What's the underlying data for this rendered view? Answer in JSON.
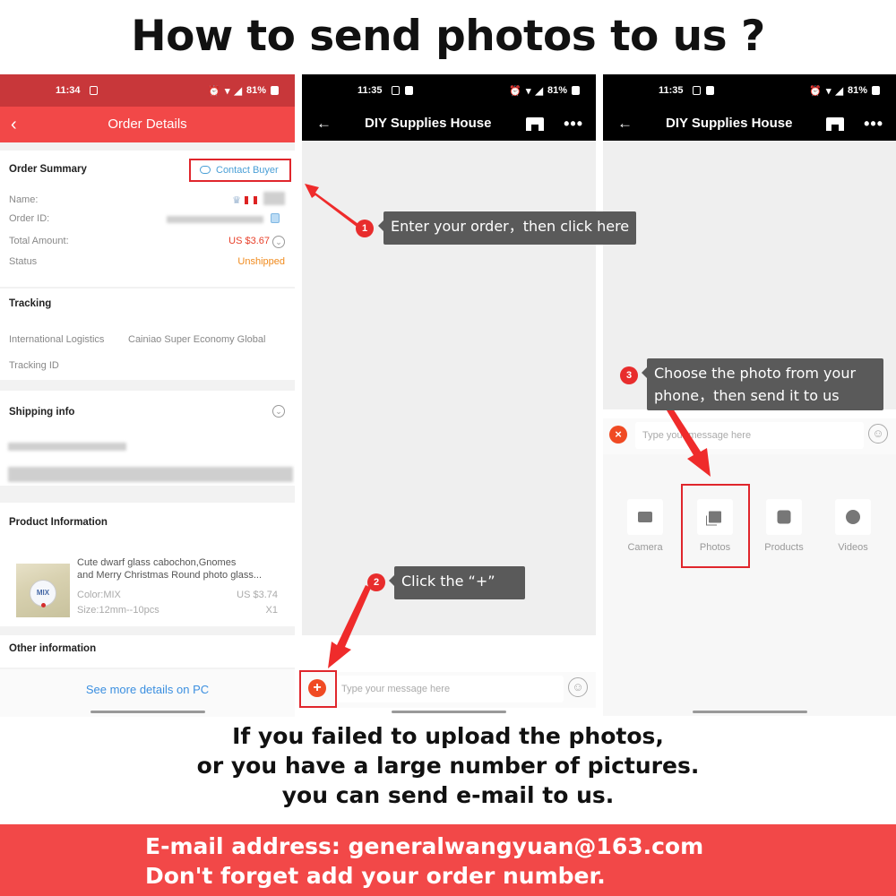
{
  "headline": "How to send photos to us ?",
  "colors": {
    "accent_red": "#f24848",
    "highlight_red": "#e0262c",
    "link_blue": "#4a9fd6",
    "price_red": "#e8402a",
    "status_orange": "#f08a1c",
    "tooltip_gray": "#5a5a5a"
  },
  "screen1": {
    "status": {
      "time": "11:34",
      "battery": "81%"
    },
    "appbar": {
      "back_icon": "chevron-left-icon",
      "title": "Order Details"
    },
    "order_summary": {
      "title": "Order Summary",
      "contact_button": "Contact Buyer",
      "fields": [
        {
          "label": "Name:",
          "value": ""
        },
        {
          "label": "Order ID:",
          "value": ""
        },
        {
          "label": "Total Amount:",
          "value": "US $3.67"
        },
        {
          "label": "Status",
          "value": "Unshipped"
        }
      ]
    },
    "tracking": {
      "title": "Tracking",
      "logistics_label": "International Logistics",
      "logistics_value": "Cainiao Super Economy Global",
      "tracking_id_label": "Tracking ID"
    },
    "shipping": {
      "title": "Shipping info"
    },
    "product": {
      "title": "Product Information",
      "image_badge": "MIX",
      "name_line1": "Cute dwarf glass cabochon,Gnomes",
      "name_line2": "and Merry Christmas Round photo glass...",
      "color": "Color:MIX",
      "size": "Size:12mm--10pcs",
      "price": "US $3.74",
      "qty": "X1"
    },
    "other": {
      "title": "Other information"
    },
    "footer_link": "See more details on PC"
  },
  "screen2": {
    "status": {
      "time": "11:35",
      "battery": "81%"
    },
    "appbar": {
      "title": "DIY Supplies House"
    },
    "message_placeholder": "Type your message here",
    "plus_label": "+"
  },
  "screen3": {
    "status": {
      "time": "11:35",
      "battery": "81%"
    },
    "appbar": {
      "title": "DIY Supplies House"
    },
    "message_placeholder": "Type your message here",
    "close_label": "×",
    "attachments": [
      {
        "label": "Camera",
        "icon": "camera-icon"
      },
      {
        "label": "Photos",
        "icon": "photos-icon"
      },
      {
        "label": "Products",
        "icon": "box-icon"
      },
      {
        "label": "Videos",
        "icon": "play-icon"
      }
    ]
  },
  "steps": [
    {
      "number": "1",
      "text": "Enter your order，then click here"
    },
    {
      "number": "2",
      "text": "Click the  “+”"
    },
    {
      "number": "3",
      "text_line1": "Choose the photo from your",
      "text_line2": "phone，then send it to us"
    }
  ],
  "note_lines": [
    "If you failed to upload the photos,",
    "or you have a large number of pictures.",
    "you can send e-mail to us."
  ],
  "email": {
    "line1": "E-mail address:   generalwangyuan@163.com",
    "line2": "Don't forget add your order number."
  }
}
